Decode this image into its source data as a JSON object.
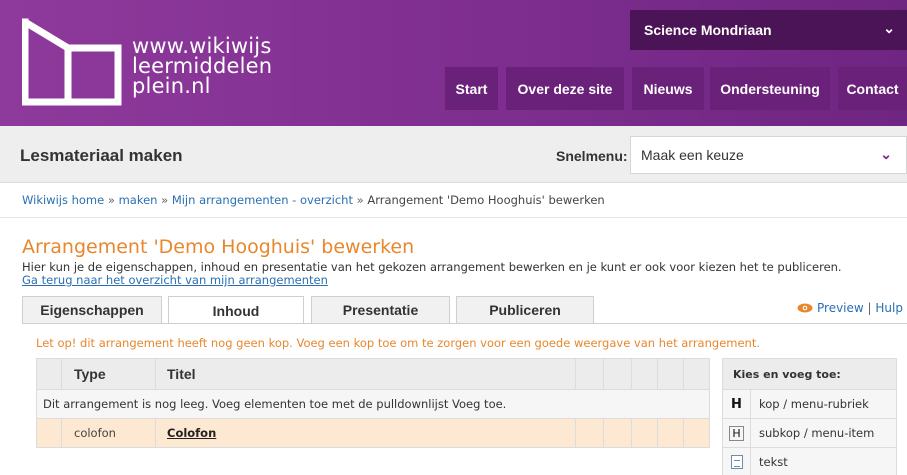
{
  "header": {
    "logo_lines": [
      "www.wikiwijs",
      "leermiddelen",
      "plein.nl"
    ],
    "org_selector": "Science Mondriaan",
    "nav": [
      "Start",
      "Over deze site",
      "Nieuws",
      "Ondersteuning",
      "Contact"
    ],
    "colors": {
      "header_bg": "#7e2e8f",
      "nav_bg": "#6a2179",
      "org_bg": "#4b1457"
    }
  },
  "subheader": {
    "title": "Lesmateriaal maken",
    "snelmenu_label": "Snelmenu:",
    "snelmenu_value": "Maak een keuze"
  },
  "breadcrumb": {
    "items": [
      "Wikiwijs home",
      "maken",
      "Mijn arrangementen - overzicht"
    ],
    "current": "Arrangement 'Demo Hooghuis' bewerken",
    "separator": "»"
  },
  "main": {
    "title": "Arrangement 'Demo Hooghuis' bewerken",
    "description": "Hier kun je de eigenschappen, inhoud en presentatie van het gekozen arrangement bewerken en je kunt er ook voor kiezen het te publiceren.",
    "back_link": "Ga terug naar het overzicht van mijn arrangementen",
    "tabs": [
      "Eigenschappen",
      "Inhoud",
      "Presentatie",
      "Publiceren"
    ],
    "active_tab": "Inhoud",
    "preview_label": "Preview",
    "help_label": "Hulp",
    "warning": "Let op! dit arrangement heeft nog geen kop. Voeg een kop toe om te zorgen voor een goede weergave van het arrangement.",
    "table": {
      "headers": [
        "Type",
        "Titel"
      ],
      "empty_message": "Dit arrangement is nog leeg. Voeg elementen toe met de pulldownlijst Voeg toe.",
      "rows": [
        {
          "type": "colofon",
          "title": "Colofon"
        }
      ]
    },
    "side_panel": {
      "heading": "Kies en voeg toe:",
      "items": [
        {
          "icon": "heading-icon",
          "label": "kop / menu-rubriek"
        },
        {
          "icon": "subheading-icon",
          "label": "subkop / menu-item"
        },
        {
          "icon": "text-document-icon",
          "label": "tekst"
        }
      ]
    },
    "colors": {
      "accent_orange": "#e8872d",
      "link_blue": "#2a6fb3",
      "row_highlight": "#fde9d2"
    }
  }
}
